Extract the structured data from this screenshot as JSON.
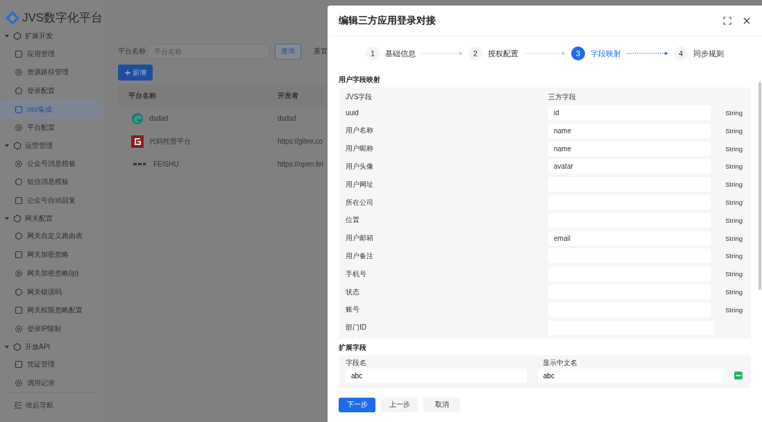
{
  "sidebar": {
    "logo": "JVS数字化平台",
    "groups": [
      {
        "label": "扩展开发",
        "expanded": true,
        "items": [
          {
            "label": "应用管理",
            "selected": false
          },
          {
            "label": "资源路径管理",
            "selected": false
          },
          {
            "label": "登录配置",
            "selected": false
          },
          {
            "label": "oss集成",
            "selected": true
          },
          {
            "label": "平台配置",
            "selected": false
          }
        ]
      },
      {
        "label": "运营管理",
        "expanded": true,
        "items": [
          {
            "label": "公众号消息模板",
            "selected": false
          },
          {
            "label": "短信消息模板",
            "selected": false
          },
          {
            "label": "公众号自动回复",
            "selected": false
          }
        ]
      },
      {
        "label": "网关配置",
        "expanded": true,
        "items": [
          {
            "label": "网关自定义路由表",
            "selected": false
          },
          {
            "label": "网关加密忽略",
            "selected": false
          },
          {
            "label": "网关加密忽略(ip)",
            "selected": false
          },
          {
            "label": "网关错误码",
            "selected": false
          },
          {
            "label": "网关权限忽略配置",
            "selected": false
          },
          {
            "label": "登录IP限制",
            "selected": false
          }
        ]
      },
      {
        "label": "开放API",
        "expanded": true,
        "items": [
          {
            "label": "凭证管理",
            "selected": false
          },
          {
            "label": "调用记录",
            "selected": false
          }
        ]
      }
    ],
    "collapse": "收起导航"
  },
  "main": {
    "search": {
      "label": "平台名称",
      "placeholder": "平台名称",
      "query": "查询",
      "reset": "重置"
    },
    "add": "新增",
    "table": {
      "columns": [
        "平台名称",
        "开发者"
      ],
      "rows": [
        {
          "kind": "swirl",
          "name": "dsdad",
          "developer": "dsdsd"
        },
        {
          "kind": "letter",
          "name": "代码托管平台",
          "developer": "https://gitee.co"
        },
        {
          "kind": "image",
          "name": "FEISHU",
          "developer": "https://open.fei"
        }
      ]
    }
  },
  "drawer": {
    "title": "编辑三方应用登录对接",
    "steps": [
      {
        "number": "1",
        "label": "基础信息",
        "selected": false
      },
      {
        "number": "2",
        "label": "授权配置",
        "selected": false
      },
      {
        "number": "3",
        "label": "字段映射",
        "selected": true
      },
      {
        "number": "4",
        "label": "同步规则",
        "selected": false
      }
    ],
    "mapping": {
      "title": "用户字段映射",
      "columns": [
        "JVS字段",
        "三方字段"
      ],
      "rows": [
        {
          "field": "uuid",
          "value": "id",
          "type": "String"
        },
        {
          "field": "用户名称",
          "value": "name",
          "type": "String"
        },
        {
          "field": "用户昵称",
          "value": "name",
          "type": "String"
        },
        {
          "field": "用户头像",
          "value": "avatar",
          "type": "String"
        },
        {
          "field": "用户网址",
          "type": "String"
        },
        {
          "field": "所在公司",
          "type": "String"
        },
        {
          "field": "位置",
          "type": "String"
        },
        {
          "field": "用户邮箱",
          "value": "email",
          "type": "String"
        },
        {
          "field": "用户备注",
          "type": "String"
        },
        {
          "field": "手机号",
          "type": "String"
        },
        {
          "field": "状态",
          "type": "String"
        },
        {
          "field": "账号",
          "type": "String"
        },
        {
          "field": "部门ID"
        }
      ]
    },
    "extension": {
      "title": "扩展字段",
      "columns": [
        "字段名",
        "显示中文名"
      ],
      "rows": [
        {
          "name": "abc",
          "label": "abc"
        }
      ]
    },
    "buttons": [
      {
        "label": "下一步",
        "kind": "primary"
      },
      {
        "label": "上一步",
        "kind": "plain"
      },
      {
        "label": "取消",
        "kind": "plain"
      }
    ]
  }
}
